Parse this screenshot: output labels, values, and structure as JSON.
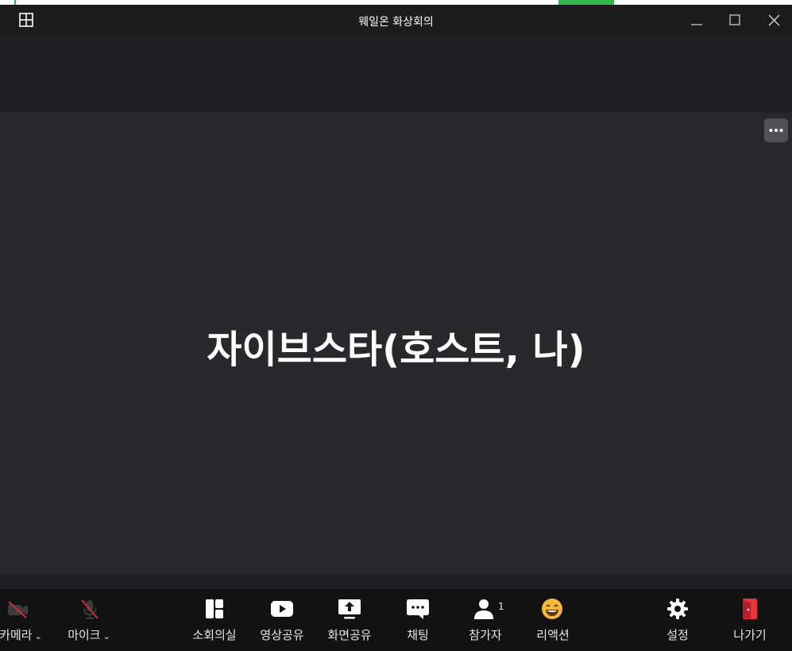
{
  "window": {
    "title": "웨일온 화상회의"
  },
  "video": {
    "participant_name": "자이브스타(호스트, 나)"
  },
  "toolbar": {
    "camera_label": "카메라",
    "mic_label": "마이크",
    "breakout_label": "소회의실",
    "video_share_label": "영상공유",
    "screen_share_label": "화면공유",
    "chat_label": "채팅",
    "participants_label": "참가자",
    "participants_count": "1",
    "reaction_label": "리액션",
    "settings_label": "설정",
    "leave_label": "나가기"
  },
  "colors": {
    "video_bg": "#29282d",
    "toolbar_bg": "#121212",
    "leave_accent": "#e5343e",
    "reaction_accent": "#f6b73c",
    "muted_slash": "#c8323b"
  }
}
